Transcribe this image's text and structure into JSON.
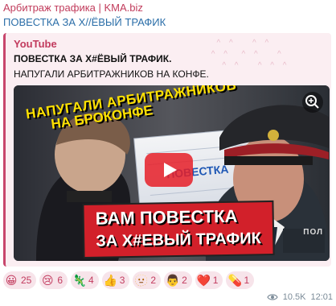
{
  "message": {
    "channel_name": "Арбитраж трафика | KMA.biz",
    "text": "ПОВЕСТКА ЗА Х//ЁВЫЙ ТРАФИК",
    "preview": {
      "site_name": "YouTube",
      "title": "ПОВЕСТКА ЗА Х#ЁВЫЙ ТРАФИК.",
      "description": "НАПУГАЛИ АРБИТРАЖНИКОВ НА КОНФЕ.",
      "thumbnail": {
        "top_text_1": "НАПУГАЛИ АРБИТРАЖНИКОВ",
        "top_text_2": "НА БРОКОНФЕ",
        "center_text": "ПОВЕСТКА",
        "banner_text_1": "ВАМ ПОВЕСТКА",
        "banner_text_2": "ЗА Х#ЕВЫЙ ТРАФИК",
        "corner_text": "ПОЛ",
        "zoom_icon": "zoom-in-icon",
        "play_icon": "play-icon"
      }
    },
    "reactions": [
      {
        "emoji": "😀",
        "count": "25",
        "icon": "grinning-face-icon"
      },
      {
        "emoji": "😢",
        "count": "6",
        "icon": "crying-face-icon"
      },
      {
        "emoji": "🦎",
        "count": "4",
        "icon": "lizard-icon"
      },
      {
        "emoji": "👍",
        "count": "3",
        "icon": "thumbs-up-icon"
      },
      {
        "emoji": "🫥",
        "count": "2",
        "icon": "face-sticker-icon"
      },
      {
        "emoji": "👨",
        "count": "2",
        "icon": "man-face-icon"
      },
      {
        "emoji": "❤️",
        "count": "1",
        "icon": "heart-icon"
      },
      {
        "emoji": "💊",
        "count": "1",
        "icon": "pill-icon"
      }
    ],
    "meta": {
      "views": "10.5K",
      "time": "12:01"
    }
  },
  "colors": {
    "channel_name": "#c13c5c",
    "link_blue": "#2b6ea8",
    "preview_bg": "#fbeef2",
    "preview_border": "#c8466c",
    "reaction_bg": "#f7e4ea",
    "reaction_text": "#c23b5e",
    "meta_gray": "#7b8b98"
  }
}
